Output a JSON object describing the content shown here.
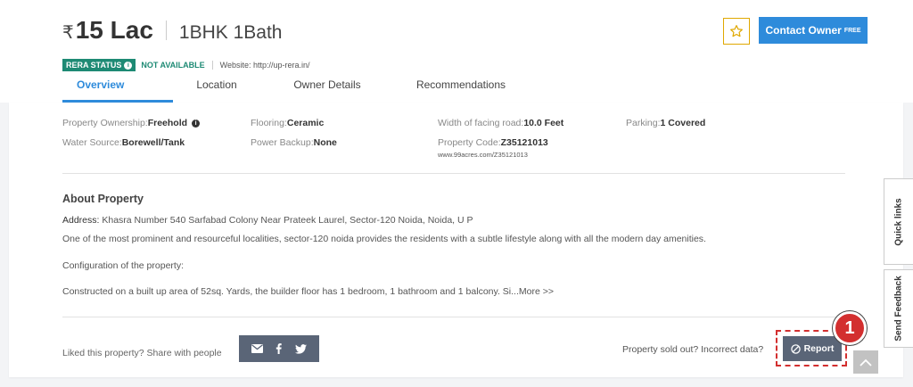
{
  "header": {
    "currency_symbol": "₹",
    "price": "15 Lac",
    "config": "1BHK 1Bath",
    "contact_button": {
      "label": "Contact Owner",
      "badge": "FREE"
    },
    "shortlist_icon": "star-outline-icon"
  },
  "rera": {
    "badge": "RERA STATUS",
    "status": "NOT AVAILABLE",
    "website": "Website: http://up-rera.in/"
  },
  "tabs": [
    {
      "label": "Overview",
      "active": true
    },
    {
      "label": "Location",
      "active": false
    },
    {
      "label": "Owner Details",
      "active": false
    },
    {
      "label": "Recommendations",
      "active": false
    }
  ],
  "specs": {
    "ownership": {
      "label": "Property Ownership:",
      "value": "Freehold"
    },
    "flooring": {
      "label": "Flooring:",
      "value": "Ceramic"
    },
    "road_width": {
      "label": "Width of facing road:",
      "value": "10.0 Feet"
    },
    "parking": {
      "label": "Parking:",
      "value": "1 Covered"
    },
    "water": {
      "label": "Water Source:",
      "value": "Borewell/Tank"
    },
    "power": {
      "label": "Power Backup:",
      "value": "None"
    },
    "code": {
      "label": "Property Code:",
      "value": "Z35121013",
      "url": "www.99acres.com/Z35121013"
    }
  },
  "about": {
    "title": "About Property",
    "address_label": "Address:",
    "address": "Khasra Number 540 Sarfabad Colony Near Prateek Laurel, Sector-120 Noida, Noida, U P",
    "line1": "One of the most prominent and resourceful localities, sector-120 noida provides the residents with a subtle lifestyle along with all the modern day amenities.",
    "line2": "Configuration of the property:",
    "line3": "Constructed on a built up area of 52sq. Yards, the builder floor has 1 bedroom, 1 bathroom and 1 balcony. Si...",
    "more": "More >>"
  },
  "share": {
    "label": "Liked this property? Share with people",
    "icons": [
      "mail-icon",
      "facebook-icon",
      "twitter-icon"
    ]
  },
  "report": {
    "prompt": "Property sold out? Incorrect data?",
    "button": "Report",
    "annotation_number": "1"
  },
  "side_tabs": {
    "quick_links": "Quick links",
    "feedback": "Send Feedback"
  },
  "colors": {
    "accent": "#2e8bdb",
    "rera_green": "#1e8a74",
    "button_dark": "#5a6577",
    "annotation_red": "#d32f2f"
  }
}
